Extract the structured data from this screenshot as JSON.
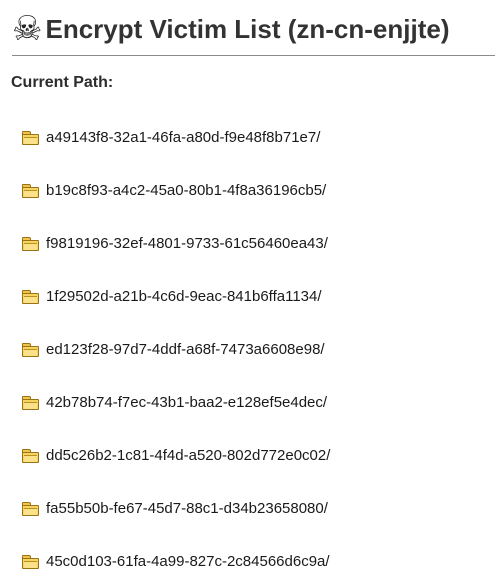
{
  "header": {
    "icon": "skull-and-crossbones-icon",
    "title": "Encrypt Victim List (zn-cn-enjjte)"
  },
  "path_label": "Current Path:",
  "entries": [
    {
      "name": "a49143f8-32a1-46fa-a80d-f9e48f8b71e7/"
    },
    {
      "name": "b19c8f93-a4c2-45a0-80b1-4f8a36196cb5/"
    },
    {
      "name": "f9819196-32ef-4801-9733-61c56460ea43/"
    },
    {
      "name": "1f29502d-a21b-4c6d-9eac-841b6ffa1134/"
    },
    {
      "name": "ed123f28-97d7-4ddf-a68f-7473a6608e98/"
    },
    {
      "name": "42b78b74-f7ec-43b1-baa2-e128ef5e4dec/"
    },
    {
      "name": "dd5c26b2-1c81-4f4d-a520-802d772e0c02/"
    },
    {
      "name": "fa55b50b-fe67-45d7-88c1-d34b23658080/"
    },
    {
      "name": "45c0d103-61fa-4a99-827c-2c84566d6c9a/"
    }
  ]
}
